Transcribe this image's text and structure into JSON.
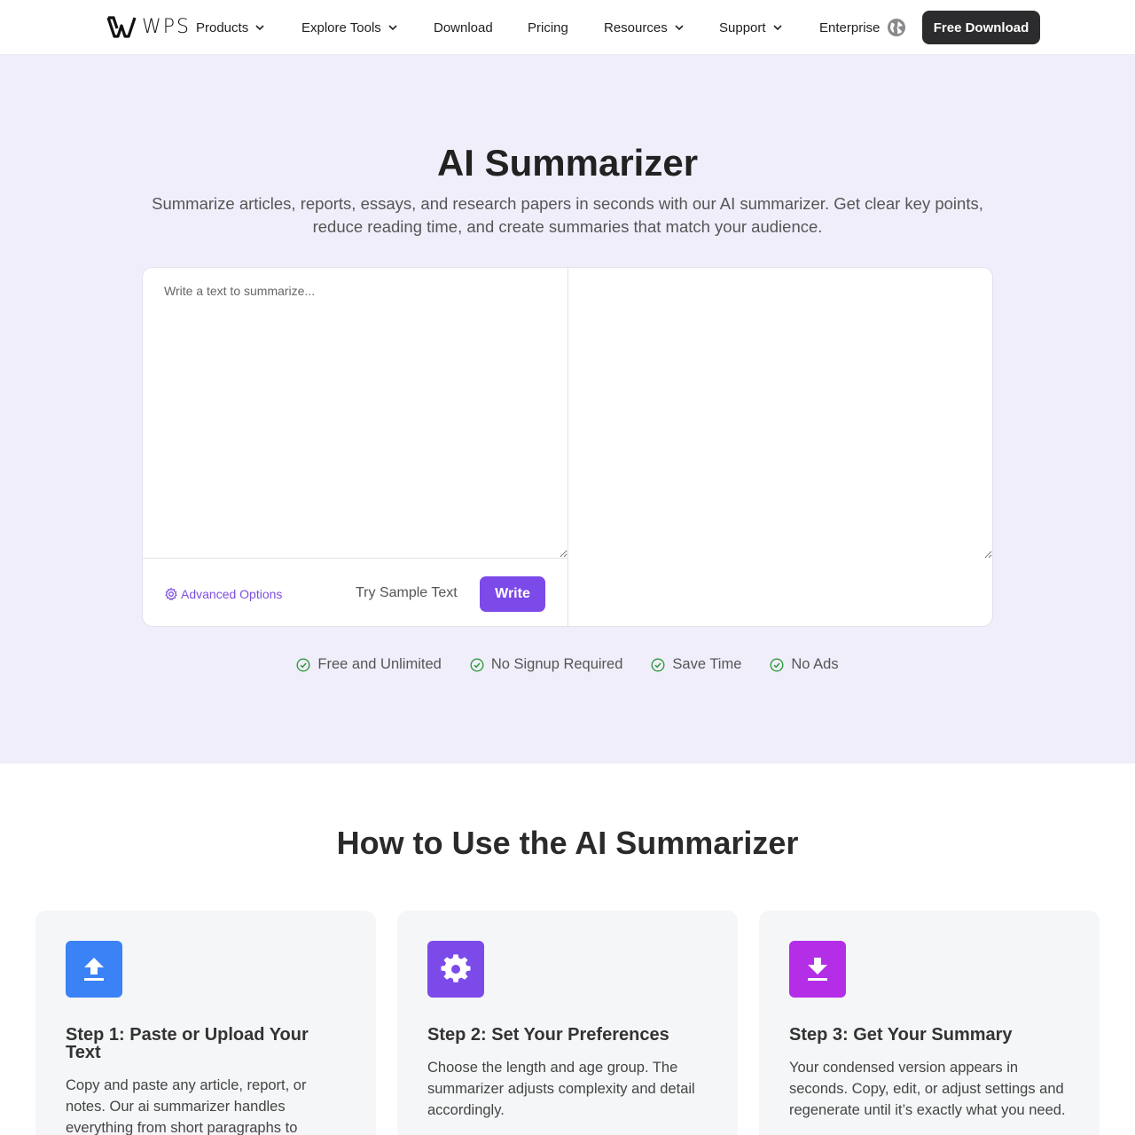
{
  "nav": {
    "logo_text": "WPS",
    "items": [
      {
        "label": "Products",
        "dropdown": true
      },
      {
        "label": "Explore Tools",
        "dropdown": true
      },
      {
        "label": "Download",
        "dropdown": false
      },
      {
        "label": "Pricing",
        "dropdown": false
      },
      {
        "label": "Resources",
        "dropdown": true
      },
      {
        "label": "Support",
        "dropdown": true
      },
      {
        "label": "Enterprise",
        "dropdown": false
      }
    ],
    "language_icon": "globe-icon",
    "cta_label": "Free Download"
  },
  "hero": {
    "title": "AI Summarizer",
    "subtitle": "Summarize articles, reports, essays, and research papers in seconds with our AI summarizer. Get clear key points, reduce reading time, and create summaries that match your audience."
  },
  "tool": {
    "input_placeholder": "Write a text to summarize...",
    "input_value": "",
    "output_value": "",
    "advanced_label": "Advanced Options",
    "sample_label": "Try Sample Text",
    "write_label": "Write"
  },
  "features": [
    {
      "label": "Free and Unlimited",
      "icon": "check-circle-icon"
    },
    {
      "label": "No Signup Required",
      "icon": "check-circle-icon"
    },
    {
      "label": "Save Time",
      "icon": "check-circle-icon"
    },
    {
      "label": "No Ads",
      "icon": "check-circle-icon"
    }
  ],
  "how": {
    "title": "How to Use the AI Summarizer",
    "steps": [
      {
        "title": "Step 1: Paste or Upload Your Text",
        "text": "Copy and paste any article, report, or notes. Our ai summarizer handles everything from short paragraphs to",
        "icon": "upload-icon",
        "color": "#3b82f6"
      },
      {
        "title": "Step 2: Set Your Preferences",
        "text": "Choose the length and age group. The summarizer adjusts complexity and detail accordingly.",
        "icon": "gear-icon",
        "color": "#7c4ae8"
      },
      {
        "title": "Step 3: Get Your Summary",
        "text": "Your condensed version appears in seconds. Copy, edit, or adjust settings and regenerate until it’s exactly what you need.",
        "icon": "download-icon",
        "color": "#b42ee8"
      }
    ]
  },
  "colors": {
    "accent": "#7c4ae8",
    "hero_bg": "#f1eefb",
    "check": "#2e9b3a",
    "cta_bg": "#2c2c2e"
  }
}
